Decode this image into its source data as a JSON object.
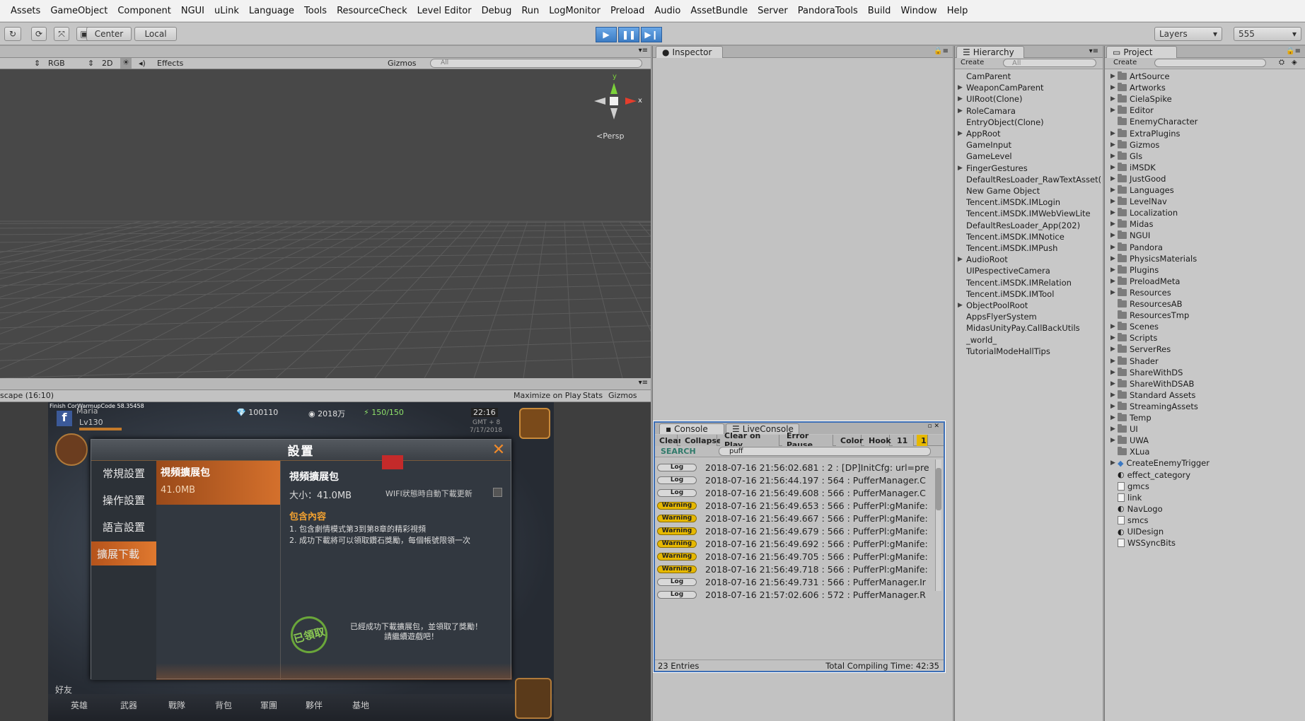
{
  "menu": [
    "Assets",
    "GameObject",
    "Component",
    "NGUI",
    "uLink",
    "Language",
    "Tools",
    "ResourceCheck",
    "Level Editor",
    "Debug",
    "Run",
    "LogMonitor",
    "Preload",
    "Audio",
    "AssetBundle",
    "Server",
    "PandoraTools",
    "Build",
    "Window",
    "Help"
  ],
  "toolbar": {
    "center_label": "Center",
    "local_label": "Local",
    "layers_label": "Layers",
    "layout_label": "555"
  },
  "scene": {
    "shading": "RGB",
    "mode_2d": "2D",
    "effects": "Effects",
    "gizmos": "Gizmos",
    "search_placeholder": "All",
    "persp": "Persp",
    "axis_y": "y",
    "axis_x": "x"
  },
  "game": {
    "aspect": "scape (16:10)",
    "maximize": "Maximize on Play",
    "stats": "Stats",
    "gizmos": "Gizmos"
  },
  "game_view": {
    "debug_text": "Finish CorWarmupCode 58.35458",
    "player_name": "Maria",
    "level": "Lv130",
    "currency_1": "100110",
    "currency_2": "2018万",
    "stamina": "150/150",
    "time": "22:16",
    "gmt": "GMT + 8",
    "date": "7/17/2018",
    "dialog": {
      "title": "設置",
      "menu": [
        "常規設置",
        "操作設置",
        "語言設置",
        "擴展下載"
      ],
      "item_title": "視頻擴展包",
      "item_size": "41.0MB",
      "detail_title": "視頻擴展包",
      "detail_size": "大小：41.0MB",
      "wifi": "WIFI狀態時自動下載更新",
      "contents_title": "包含內容",
      "line1": "1. 包含劇情模式第3到第8章的精彩視頻",
      "line2": "2. 成功下載將可以領取鑽石獎勵，每個帳號限領一次",
      "stamp": "已領取",
      "footer1": "已經成功下載擴展包，並領取了獎勵！",
      "footer2": "請繼續遊戲吧！"
    },
    "bottom": [
      "英雄",
      "武器",
      "戰隊",
      "背包",
      "軍團",
      "夥伴",
      "基地"
    ],
    "friend": "好友"
  },
  "inspector": {
    "tab": "Inspector"
  },
  "console": {
    "tab1": "Console",
    "tab2": "LiveConsole",
    "buttons": [
      "Clear",
      "Collapse",
      "Clear on Play",
      "Error Pause",
      "Color",
      "Hook",
      "11",
      "1"
    ],
    "search_label": "SEARCH",
    "search_value": "puff",
    "entries": [
      {
        "type": "Log",
        "text": "2018-07-16 21:56:02.681 : 2 : [DP]InitCfg: url=pre"
      },
      {
        "type": "Log",
        "text": "2018-07-16 21:56:44.197 : 564 : PufferManager.C"
      },
      {
        "type": "Log",
        "text": "2018-07-16 21:56:49.608 : 566 : PufferManager.C"
      },
      {
        "type": "Warning",
        "text": "2018-07-16 21:56:49.653 : 566 : PufferPl:gManife:"
      },
      {
        "type": "Warning",
        "text": "2018-07-16 21:56:49.667 : 566 : PufferPl:gManife:"
      },
      {
        "type": "Warning",
        "text": "2018-07-16 21:56:49.679 : 566 : PufferPl:gManife:"
      },
      {
        "type": "Warning",
        "text": "2018-07-16 21:56:49.692 : 566 : PufferPl:gManife:"
      },
      {
        "type": "Warning",
        "text": "2018-07-16 21:56:49.705 : 566 : PufferPl:gManife:"
      },
      {
        "type": "Warning",
        "text": "2018-07-16 21:56:49.718 : 566 : PufferPl:gManife:"
      },
      {
        "type": "Log",
        "text": "2018-07-16 21:56:49.731 : 566 : PufferManager.Ir"
      },
      {
        "type": "Log",
        "text": "2018-07-16 21:57:02.606 : 572 : PufferManager.R"
      }
    ],
    "entries_count": "23 Entries",
    "compile_time": "Total Compiling Time: 42:35"
  },
  "hierarchy": {
    "tab": "Hierarchy",
    "create": "Create",
    "search_placeholder": "All",
    "items": [
      {
        "label": "CamParent",
        "arrow": false
      },
      {
        "label": "WeaponCamParent",
        "arrow": true
      },
      {
        "label": "UIRoot(Clone)",
        "arrow": true
      },
      {
        "label": "RoleCamara",
        "arrow": true
      },
      {
        "label": "EntryObject(Clone)",
        "arrow": false
      },
      {
        "label": "AppRoot",
        "arrow": true
      },
      {
        "label": "GameInput",
        "arrow": false
      },
      {
        "label": "GameLevel",
        "arrow": false
      },
      {
        "label": "FingerGestures",
        "arrow": true
      },
      {
        "label": "DefaultResLoader_RawTextAsset(",
        "arrow": false
      },
      {
        "label": "New Game Object",
        "arrow": false
      },
      {
        "label": "Tencent.iMSDK.IMLogin",
        "arrow": false
      },
      {
        "label": "Tencent.iMSDK.IMWebViewLite",
        "arrow": false
      },
      {
        "label": "DefaultResLoader_App(202)",
        "arrow": false
      },
      {
        "label": "Tencent.iMSDK.IMNotice",
        "arrow": false
      },
      {
        "label": "Tencent.iMSDK.IMPush",
        "arrow": false
      },
      {
        "label": "AudioRoot",
        "arrow": true
      },
      {
        "label": "UIPespectiveCamera",
        "arrow": false
      },
      {
        "label": "Tencent.iMSDK.IMRelation",
        "arrow": false
      },
      {
        "label": "Tencent.iMSDK.IMTool",
        "arrow": false
      },
      {
        "label": "ObjectPoolRoot",
        "arrow": true
      },
      {
        "label": "AppsFlyerSystem",
        "arrow": false
      },
      {
        "label": "MidasUnityPay.CallBackUtils",
        "arrow": false
      },
      {
        "label": "_world_",
        "arrow": false
      },
      {
        "label": "TutorialModeHallTips",
        "arrow": false
      }
    ]
  },
  "project": {
    "tab": "Project",
    "create": "Create",
    "items": [
      {
        "label": "ArtSource",
        "kind": "folder",
        "arrow": true
      },
      {
        "label": "Artworks",
        "kind": "folder",
        "arrow": true
      },
      {
        "label": "CielaSpike",
        "kind": "folder",
        "arrow": true
      },
      {
        "label": "Editor",
        "kind": "folder",
        "arrow": true
      },
      {
        "label": "EnemyCharacter",
        "kind": "folder",
        "arrow": false
      },
      {
        "label": "ExtraPlugins",
        "kind": "folder",
        "arrow": true
      },
      {
        "label": "Gizmos",
        "kind": "folder",
        "arrow": true
      },
      {
        "label": "Gls",
        "kind": "folder",
        "arrow": true
      },
      {
        "label": "iMSDK",
        "kind": "folder",
        "arrow": true
      },
      {
        "label": "JustGood",
        "kind": "folder",
        "arrow": true
      },
      {
        "label": "Languages",
        "kind": "folder",
        "arrow": true
      },
      {
        "label": "LevelNav",
        "kind": "folder",
        "arrow": true
      },
      {
        "label": "Localization",
        "kind": "folder",
        "arrow": true
      },
      {
        "label": "Midas",
        "kind": "folder",
        "arrow": true
      },
      {
        "label": "NGUI",
        "kind": "folder",
        "arrow": true
      },
      {
        "label": "Pandora",
        "kind": "folder",
        "arrow": true
      },
      {
        "label": "PhysicsMaterials",
        "kind": "folder",
        "arrow": true
      },
      {
        "label": "Plugins",
        "kind": "folder",
        "arrow": true
      },
      {
        "label": "PreloadMeta",
        "kind": "folder",
        "arrow": true
      },
      {
        "label": "Resources",
        "kind": "folder",
        "arrow": true
      },
      {
        "label": "ResourcesAB",
        "kind": "folder",
        "arrow": false
      },
      {
        "label": "ResourcesTmp",
        "kind": "folder",
        "arrow": false
      },
      {
        "label": "Scenes",
        "kind": "folder",
        "arrow": true
      },
      {
        "label": "Scripts",
        "kind": "folder",
        "arrow": true
      },
      {
        "label": "ServerRes",
        "kind": "folder",
        "arrow": true
      },
      {
        "label": "Shader",
        "kind": "folder",
        "arrow": true
      },
      {
        "label": "ShareWithDS",
        "kind": "folder",
        "arrow": true
      },
      {
        "label": "ShareWithDSAB",
        "kind": "folder",
        "arrow": true
      },
      {
        "label": "Standard Assets",
        "kind": "folder",
        "arrow": true
      },
      {
        "label": "StreamingAssets",
        "kind": "folder",
        "arrow": true
      },
      {
        "label": "Temp",
        "kind": "folder",
        "arrow": true
      },
      {
        "label": "UI",
        "kind": "folder",
        "arrow": true
      },
      {
        "label": "UWA",
        "kind": "folder",
        "arrow": true
      },
      {
        "label": "XLua",
        "kind": "folder",
        "arrow": false
      },
      {
        "label": "CreateEnemyTrigger",
        "kind": "prefab",
        "arrow": true
      },
      {
        "label": "effect_category",
        "kind": "asset",
        "arrow": false
      },
      {
        "label": "gmcs",
        "kind": "file",
        "arrow": false
      },
      {
        "label": "link",
        "kind": "file",
        "arrow": false
      },
      {
        "label": "NavLogo",
        "kind": "asset",
        "arrow": false
      },
      {
        "label": "smcs",
        "kind": "file",
        "arrow": false
      },
      {
        "label": "UIDesign",
        "kind": "asset",
        "arrow": false
      },
      {
        "label": "WSSyncBits",
        "kind": "file",
        "arrow": false
      }
    ]
  },
  "colors": {
    "play_blue": "#3c7cc4",
    "warning_yellow": "#e6b800",
    "console_border": "#3d6fb6",
    "dialog_orange": "#c9692a"
  }
}
